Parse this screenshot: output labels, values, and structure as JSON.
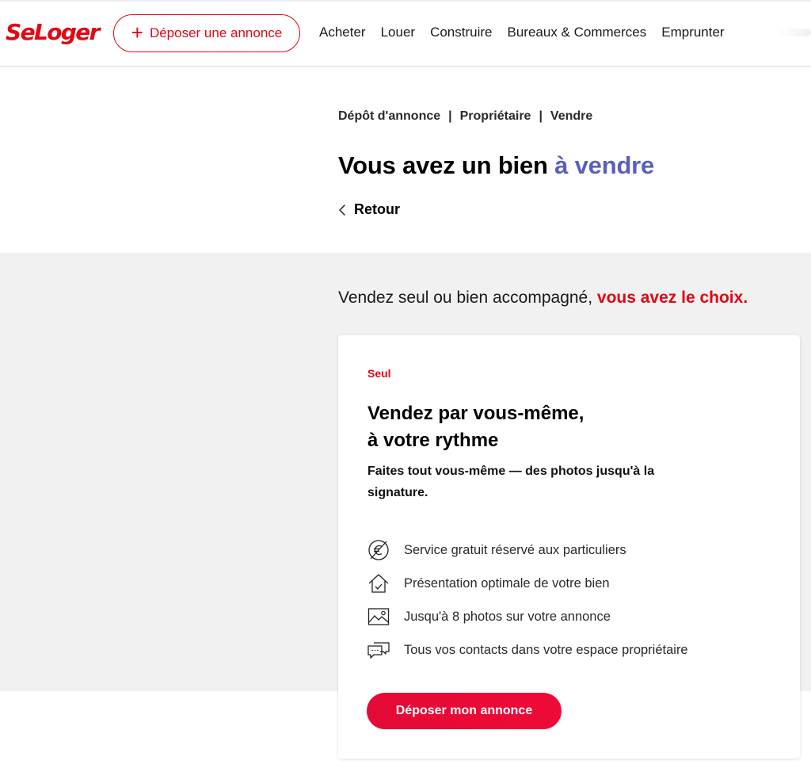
{
  "header": {
    "logo": "SeLoger",
    "post_button": {
      "icon": "plus-icon",
      "label": "Déposer une annonce"
    },
    "nav": [
      "Acheter",
      "Louer",
      "Construire",
      "Bureaux & Commerces",
      "Emprunter"
    ]
  },
  "breadcrumb": [
    "Dépôt d'annonce",
    "Propriétaire",
    "Vendre"
  ],
  "breadcrumb_separator": "|",
  "title": {
    "text": "Vous avez un bien ",
    "accent": "à vendre"
  },
  "back": {
    "icon": "chevron-left-icon",
    "label": "Retour"
  },
  "choice": {
    "text": "Vendez seul ou bien accompagné, ",
    "accent": "vous avez le choix."
  },
  "card": {
    "tag": "Seul",
    "heading_line1": "Vendez par vous-même,",
    "heading_line2": "à votre rythme",
    "subtitle": "Faites tout vous-même — des photos jusqu'à la signature.",
    "features": [
      {
        "icon": "no-euro-icon",
        "text": "Service gratuit réservé aux particuliers"
      },
      {
        "icon": "house-check-icon",
        "text": "Présentation optimale de votre bien"
      },
      {
        "icon": "photo-icon",
        "text": "Jusqu'à 8 photos sur votre annonce"
      },
      {
        "icon": "chat-bubbles-icon",
        "text": "Tous vos contacts dans votre espace propriétaire"
      }
    ],
    "cta": "Déposer mon annonce"
  },
  "colors": {
    "brand_red": "#e30613",
    "accent_purple": "#5a5ebd",
    "band_grey": "#f1f1f1"
  }
}
